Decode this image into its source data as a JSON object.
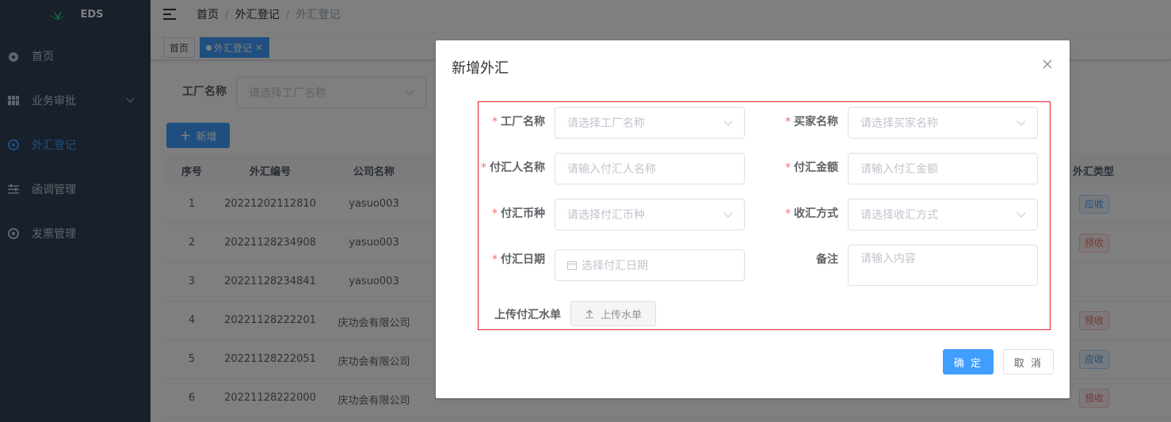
{
  "app": {
    "logo_text": "EDS"
  },
  "sidebar": {
    "items": [
      {
        "label": "首页",
        "icon": "dashboard-icon"
      },
      {
        "label": "业务审批",
        "icon": "grid-icon"
      },
      {
        "label": "外汇登记",
        "icon": "target-icon",
        "active": true
      },
      {
        "label": "函调管理",
        "icon": "sliders-icon"
      },
      {
        "label": "发票管理",
        "icon": "target-icon"
      }
    ]
  },
  "breadcrumb": [
    "首页",
    "外汇登记",
    "外汇登记"
  ],
  "tags": [
    {
      "label": "首页"
    },
    {
      "label": "外汇登记",
      "active": true
    }
  ],
  "filter": {
    "label": "工厂名称",
    "placeholder": "请选择工厂名称"
  },
  "toolbar": {
    "add_label": "新增"
  },
  "table": {
    "columns": [
      "序号",
      "外汇编号",
      "公司名称",
      "外汇类型"
    ],
    "rows": [
      {
        "index": "1",
        "code": "20221202112810",
        "company": "yasuo003",
        "type": "应收"
      },
      {
        "index": "2",
        "code": "20221128234908",
        "company": "yasuo003",
        "type": "预收"
      },
      {
        "index": "3",
        "code": "20221128234841",
        "company": "yasuo003",
        "type": ""
      },
      {
        "index": "4",
        "code": "20221128222201",
        "company": "庆功会有限公司",
        "type": "预收"
      },
      {
        "index": "5",
        "code": "20221128222051",
        "company": "庆功会有限公司",
        "type": "应收"
      },
      {
        "index": "6",
        "code": "20221128222000",
        "company": "庆功会有限公司",
        "type": "预收"
      }
    ]
  },
  "colors": {
    "accent": "#409eff",
    "sidebar_bg": "#304156",
    "danger": "#f56c6c"
  },
  "dialog": {
    "title": "新增外汇",
    "fields": {
      "factory": {
        "label": "工厂名称",
        "placeholder": "请选择工厂名称",
        "required": true
      },
      "buyer": {
        "label": "买家名称",
        "placeholder": "请选择买家名称",
        "required": true
      },
      "payer": {
        "label": "付汇人名称",
        "placeholder": "请输入付汇人名称",
        "required": true
      },
      "amount": {
        "label": "付汇金额",
        "placeholder": "请输入付汇金额",
        "required": true
      },
      "currency": {
        "label": "付汇币种",
        "placeholder": "请选择付汇币种",
        "required": true
      },
      "receive_method": {
        "label": "收汇方式",
        "placeholder": "请选择收汇方式",
        "required": true
      },
      "date": {
        "label": "付汇日期",
        "placeholder": "选择付汇日期",
        "required": true
      },
      "remark": {
        "label": "备注",
        "placeholder": "请输入内容"
      },
      "upload": {
        "label": "上传付汇水单",
        "button": "上传水单"
      }
    },
    "confirm_label": "确 定",
    "cancel_label": "取 消"
  }
}
